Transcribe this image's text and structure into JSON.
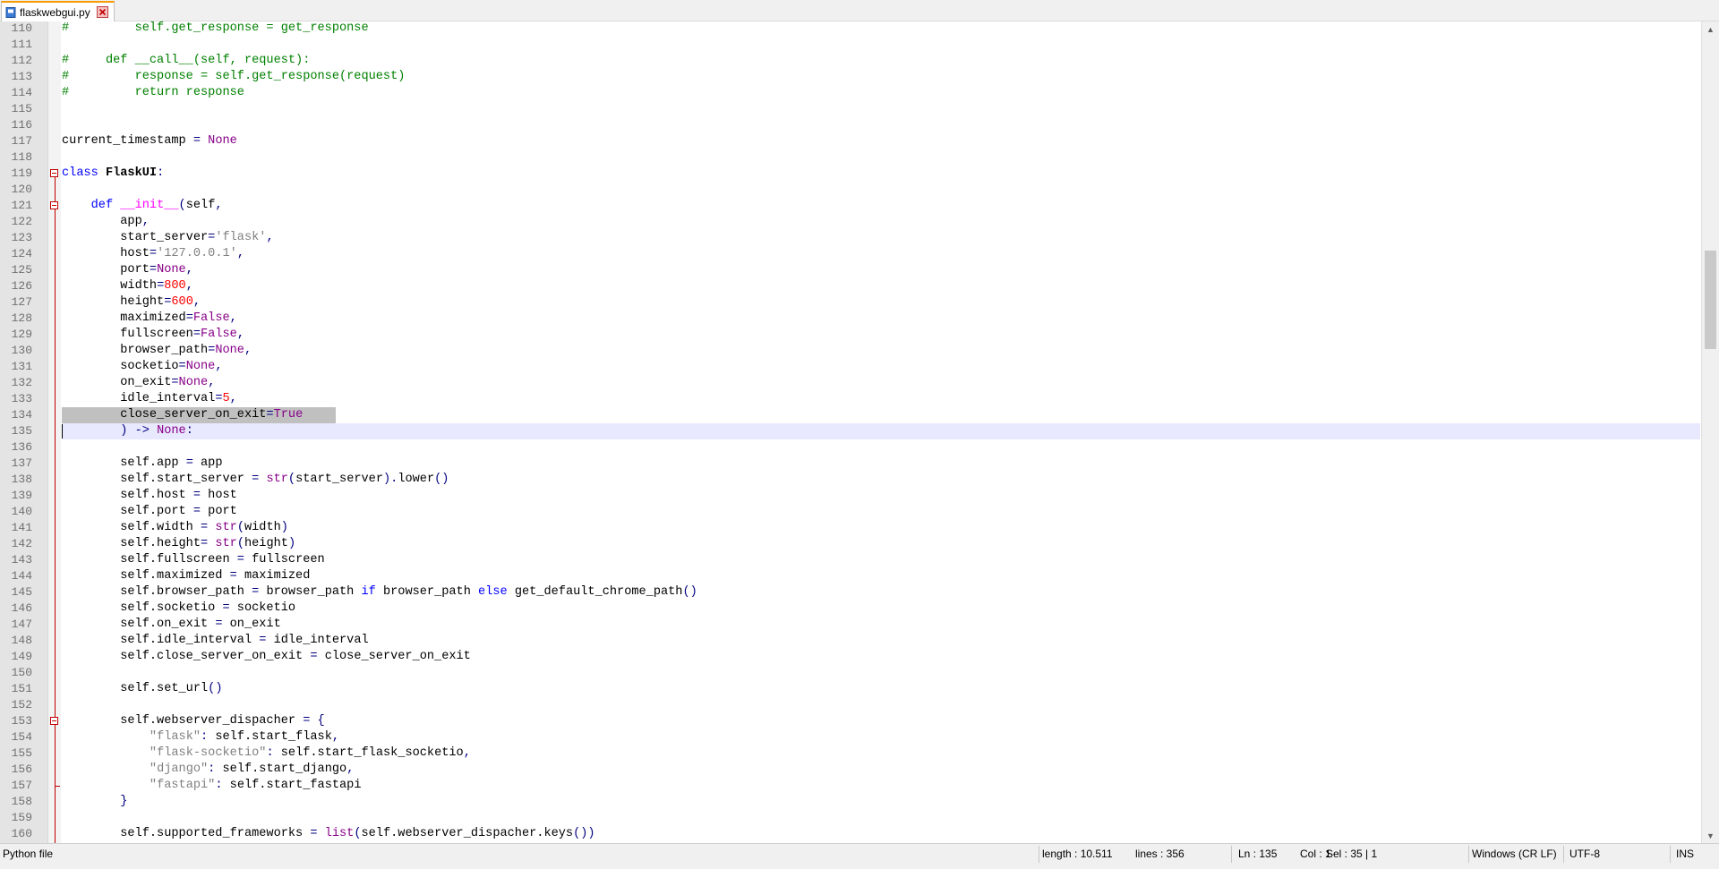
{
  "tab": {
    "filename": "flaskwebgui.py",
    "icons": {
      "file": "python-file-icon",
      "close": "close-icon"
    }
  },
  "editor": {
    "lines": [
      {
        "n": "110",
        "tokens": [
          [
            "c-com",
            "#         self.get_response = get_response"
          ]
        ]
      },
      {
        "n": "111",
        "tokens": []
      },
      {
        "n": "112",
        "tokens": [
          [
            "c-com",
            "#     def __call__(self, request):"
          ]
        ]
      },
      {
        "n": "113",
        "tokens": [
          [
            "c-com",
            "#         response = self.get_response(request)"
          ]
        ]
      },
      {
        "n": "114",
        "tokens": [
          [
            "c-com",
            "#         return response"
          ]
        ]
      },
      {
        "n": "115",
        "tokens": []
      },
      {
        "n": "116",
        "tokens": []
      },
      {
        "n": "117",
        "tokens": [
          [
            "c-pl",
            "current_timestamp "
          ],
          [
            "c-op",
            "= "
          ],
          [
            "c-bi",
            "None"
          ]
        ]
      },
      {
        "n": "118",
        "tokens": []
      },
      {
        "n": "119",
        "tokens": [
          [
            "c-kw",
            "class "
          ],
          [
            "c-cls",
            "FlaskUI"
          ],
          [
            "c-op",
            ":"
          ]
        ]
      },
      {
        "n": "120",
        "tokens": []
      },
      {
        "n": "121",
        "tokens": [
          [
            "c-pl",
            "    "
          ],
          [
            "c-kw",
            "def "
          ],
          [
            "c-def",
            "__init__"
          ],
          [
            "c-op",
            "("
          ],
          [
            "c-pl",
            "self"
          ],
          [
            "c-op",
            ","
          ]
        ]
      },
      {
        "n": "122",
        "tokens": [
          [
            "c-pl",
            "        app"
          ],
          [
            "c-op",
            ","
          ]
        ]
      },
      {
        "n": "123",
        "tokens": [
          [
            "c-pl",
            "        start_server"
          ],
          [
            "c-op",
            "="
          ],
          [
            "c-str",
            "'flask'"
          ],
          [
            "c-op",
            ","
          ]
        ]
      },
      {
        "n": "124",
        "tokens": [
          [
            "c-pl",
            "        host"
          ],
          [
            "c-op",
            "="
          ],
          [
            "c-str",
            "'127.0.0.1'"
          ],
          [
            "c-op",
            ","
          ]
        ]
      },
      {
        "n": "125",
        "tokens": [
          [
            "c-pl",
            "        port"
          ],
          [
            "c-op",
            "="
          ],
          [
            "c-bi",
            "None"
          ],
          [
            "c-op",
            ","
          ]
        ]
      },
      {
        "n": "126",
        "tokens": [
          [
            "c-pl",
            "        width"
          ],
          [
            "c-op",
            "="
          ],
          [
            "c-num",
            "800"
          ],
          [
            "c-op",
            ","
          ]
        ]
      },
      {
        "n": "127",
        "tokens": [
          [
            "c-pl",
            "        height"
          ],
          [
            "c-op",
            "="
          ],
          [
            "c-num",
            "600"
          ],
          [
            "c-op",
            ","
          ]
        ]
      },
      {
        "n": "128",
        "tokens": [
          [
            "c-pl",
            "        maximized"
          ],
          [
            "c-op",
            "="
          ],
          [
            "c-bi",
            "False"
          ],
          [
            "c-op",
            ","
          ]
        ]
      },
      {
        "n": "129",
        "tokens": [
          [
            "c-pl",
            "        fullscreen"
          ],
          [
            "c-op",
            "="
          ],
          [
            "c-bi",
            "False"
          ],
          [
            "c-op",
            ","
          ]
        ]
      },
      {
        "n": "130",
        "tokens": [
          [
            "c-pl",
            "        browser_path"
          ],
          [
            "c-op",
            "="
          ],
          [
            "c-bi",
            "None"
          ],
          [
            "c-op",
            ","
          ]
        ]
      },
      {
        "n": "131",
        "tokens": [
          [
            "c-pl",
            "        socketio"
          ],
          [
            "c-op",
            "="
          ],
          [
            "c-bi",
            "None"
          ],
          [
            "c-op",
            ","
          ]
        ]
      },
      {
        "n": "132",
        "tokens": [
          [
            "c-pl",
            "        on_exit"
          ],
          [
            "c-op",
            "="
          ],
          [
            "c-bi",
            "None"
          ],
          [
            "c-op",
            ","
          ]
        ]
      },
      {
        "n": "133",
        "tokens": [
          [
            "c-pl",
            "        idle_interval"
          ],
          [
            "c-op",
            "="
          ],
          [
            "c-num",
            "5"
          ],
          [
            "c-op",
            ","
          ]
        ]
      },
      {
        "n": "134",
        "tokens": [
          [
            "c-pl",
            "        close_server_on_exit"
          ],
          [
            "c-op",
            "="
          ],
          [
            "c-bi",
            "True"
          ]
        ]
      },
      {
        "n": "135",
        "tokens": [
          [
            "c-pl",
            "        "
          ],
          [
            "c-op",
            ") -> "
          ],
          [
            "c-bi",
            "None"
          ],
          [
            "c-op",
            ":"
          ]
        ]
      },
      {
        "n": "136",
        "tokens": []
      },
      {
        "n": "137",
        "tokens": [
          [
            "c-pl",
            "        self.app "
          ],
          [
            "c-op",
            "= "
          ],
          [
            "c-pl",
            "app"
          ]
        ]
      },
      {
        "n": "138",
        "tokens": [
          [
            "c-pl",
            "        self.start_server "
          ],
          [
            "c-op",
            "= "
          ],
          [
            "c-bi",
            "str"
          ],
          [
            "c-op",
            "("
          ],
          [
            "c-pl",
            "start_server"
          ],
          [
            "c-op",
            ")."
          ],
          [
            "c-pl",
            "lower"
          ],
          [
            "c-op",
            "()"
          ]
        ]
      },
      {
        "n": "139",
        "tokens": [
          [
            "c-pl",
            "        self.host "
          ],
          [
            "c-op",
            "= "
          ],
          [
            "c-pl",
            "host"
          ]
        ]
      },
      {
        "n": "140",
        "tokens": [
          [
            "c-pl",
            "        self.port "
          ],
          [
            "c-op",
            "= "
          ],
          [
            "c-pl",
            "port"
          ]
        ]
      },
      {
        "n": "141",
        "tokens": [
          [
            "c-pl",
            "        self.width "
          ],
          [
            "c-op",
            "= "
          ],
          [
            "c-bi",
            "str"
          ],
          [
            "c-op",
            "("
          ],
          [
            "c-pl",
            "width"
          ],
          [
            "c-op",
            ")"
          ]
        ]
      },
      {
        "n": "142",
        "tokens": [
          [
            "c-pl",
            "        self.height"
          ],
          [
            "c-op",
            "= "
          ],
          [
            "c-bi",
            "str"
          ],
          [
            "c-op",
            "("
          ],
          [
            "c-pl",
            "height"
          ],
          [
            "c-op",
            ")"
          ]
        ]
      },
      {
        "n": "143",
        "tokens": [
          [
            "c-pl",
            "        self.fullscreen "
          ],
          [
            "c-op",
            "= "
          ],
          [
            "c-pl",
            "fullscreen"
          ]
        ]
      },
      {
        "n": "144",
        "tokens": [
          [
            "c-pl",
            "        self.maximized "
          ],
          [
            "c-op",
            "= "
          ],
          [
            "c-pl",
            "maximized"
          ]
        ]
      },
      {
        "n": "145",
        "tokens": [
          [
            "c-pl",
            "        self.browser_path "
          ],
          [
            "c-op",
            "= "
          ],
          [
            "c-pl",
            "browser_path "
          ],
          [
            "c-kw",
            "if "
          ],
          [
            "c-pl",
            "browser_path "
          ],
          [
            "c-kw",
            "else "
          ],
          [
            "c-pl",
            "get_default_chrome_path"
          ],
          [
            "c-op",
            "()"
          ]
        ]
      },
      {
        "n": "146",
        "tokens": [
          [
            "c-pl",
            "        self.socketio "
          ],
          [
            "c-op",
            "= "
          ],
          [
            "c-pl",
            "socketio"
          ]
        ]
      },
      {
        "n": "147",
        "tokens": [
          [
            "c-pl",
            "        self.on_exit "
          ],
          [
            "c-op",
            "= "
          ],
          [
            "c-pl",
            "on_exit"
          ]
        ]
      },
      {
        "n": "148",
        "tokens": [
          [
            "c-pl",
            "        self.idle_interval "
          ],
          [
            "c-op",
            "= "
          ],
          [
            "c-pl",
            "idle_interval"
          ]
        ]
      },
      {
        "n": "149",
        "tokens": [
          [
            "c-pl",
            "        self.close_server_on_exit "
          ],
          [
            "c-op",
            "= "
          ],
          [
            "c-pl",
            "close_server_on_exit"
          ]
        ]
      },
      {
        "n": "150",
        "tokens": []
      },
      {
        "n": "151",
        "tokens": [
          [
            "c-pl",
            "        self.set_url"
          ],
          [
            "c-op",
            "()"
          ]
        ]
      },
      {
        "n": "152",
        "tokens": []
      },
      {
        "n": "153",
        "tokens": [
          [
            "c-pl",
            "        self.webserver_dispacher "
          ],
          [
            "c-op",
            "= {"
          ]
        ]
      },
      {
        "n": "154",
        "tokens": [
          [
            "c-pl",
            "            "
          ],
          [
            "c-str",
            "\"flask\""
          ],
          [
            "c-op",
            ": "
          ],
          [
            "c-pl",
            "self.start_flask"
          ],
          [
            "c-op",
            ","
          ]
        ]
      },
      {
        "n": "155",
        "tokens": [
          [
            "c-pl",
            "            "
          ],
          [
            "c-str",
            "\"flask-socketio\""
          ],
          [
            "c-op",
            ": "
          ],
          [
            "c-pl",
            "self.start_flask_socketio"
          ],
          [
            "c-op",
            ","
          ]
        ]
      },
      {
        "n": "156",
        "tokens": [
          [
            "c-pl",
            "            "
          ],
          [
            "c-str",
            "\"django\""
          ],
          [
            "c-op",
            ": "
          ],
          [
            "c-pl",
            "self.start_django"
          ],
          [
            "c-op",
            ","
          ]
        ]
      },
      {
        "n": "157",
        "tokens": [
          [
            "c-pl",
            "            "
          ],
          [
            "c-str",
            "\"fastapi\""
          ],
          [
            "c-op",
            ": "
          ],
          [
            "c-pl",
            "self.start_fastapi"
          ]
        ]
      },
      {
        "n": "158",
        "tokens": [
          [
            "c-pl",
            "        "
          ],
          [
            "c-op",
            "}"
          ]
        ]
      },
      {
        "n": "159",
        "tokens": []
      },
      {
        "n": "160",
        "tokens": [
          [
            "c-pl",
            "        self.supported_frameworks "
          ],
          [
            "c-op",
            "= "
          ],
          [
            "c-bi",
            "list"
          ],
          [
            "c-op",
            "("
          ],
          [
            "c-pl",
            "self.webserver_dispacher.keys"
          ],
          [
            "c-op",
            "())"
          ]
        ]
      }
    ],
    "current_line": "135",
    "selected_line": "134"
  },
  "statusbar": {
    "language": "Python file",
    "length": "length : 10.511",
    "lines": "lines : 356",
    "ln": "Ln : 135",
    "col": "Col : 1",
    "sel": "Sel : 35 | 1",
    "eol": "Windows (CR LF)",
    "encoding": "UTF-8",
    "mode": "INS"
  },
  "scrollbar": {
    "up_icon": "chevron-up-icon",
    "down_icon": "chevron-down-icon"
  }
}
